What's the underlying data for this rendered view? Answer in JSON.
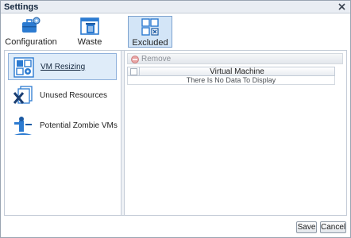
{
  "window": {
    "title": "Settings"
  },
  "toolbar": {
    "items": [
      {
        "label": "Configuration",
        "icon": "briefcase-gear-icon"
      },
      {
        "label": "Waste",
        "icon": "trash-window-icon"
      },
      {
        "label": "Excluded",
        "icon": "excluded-grid-icon"
      }
    ],
    "selected": "Excluded"
  },
  "nav": {
    "items": [
      {
        "label": "VM Resizing",
        "icon": "vm-resizing-icon"
      },
      {
        "label": "Unused Resources",
        "icon": "unused-resources-icon"
      },
      {
        "label": "Potential Zombie VMs",
        "icon": "zombie-vm-icon"
      }
    ],
    "selected": "VM Resizing"
  },
  "content": {
    "remove_label": "Remove",
    "grid": {
      "columns": [
        "Virtual Machine"
      ],
      "empty_text": "There Is No Data To Display"
    }
  },
  "footer": {
    "save_label": "Save",
    "cancel_label": "Cancel"
  },
  "colors": {
    "accent": "#2c7bd1",
    "selection": "#dfecf9",
    "titlebar": "#e9edf3"
  }
}
